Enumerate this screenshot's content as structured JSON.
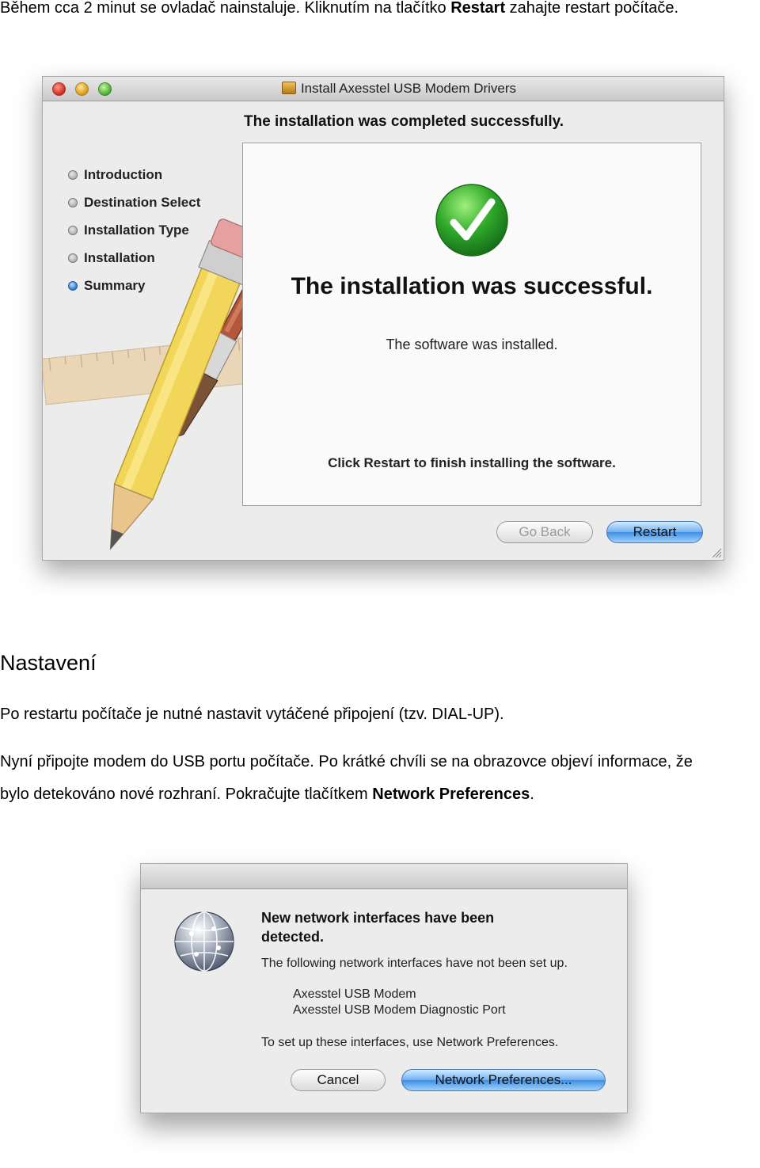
{
  "intro_paragraph": {
    "prefix": "Během cca 2 minut se ovladač nainstaluje. Kliknutím na tlačítko ",
    "bold": "Restart",
    "suffix": " zahajte restart počítače."
  },
  "installer_window": {
    "title": "Install Axesstel USB Modem Drivers",
    "header": "The installation was completed successfully.",
    "steps": [
      {
        "label": "Introduction",
        "active": false
      },
      {
        "label": "Destination Select",
        "active": false
      },
      {
        "label": "Installation Type",
        "active": false
      },
      {
        "label": "Installation",
        "active": false
      },
      {
        "label": "Summary",
        "active": true
      }
    ],
    "success_title": "The installation was successful.",
    "success_sub": "The software was installed.",
    "success_hint": "Click Restart to finish installing the software.",
    "go_back_label": "Go Back",
    "restart_label": "Restart",
    "success_icon": "check-icon",
    "success_color": "#2fa82a"
  },
  "section_heading": "Nastavení",
  "paragraph_2": "Po restartu počítače je nutné nastavit vytáčené připojení (tzv. DIAL-UP).",
  "paragraph_3": {
    "line1": "Nyní připojte modem do USB portu počítače. Po krátké chvíli se na obrazovce objeví informace, že",
    "line2_prefix": "bylo detekováno nové rozhraní. Pokračujte tlačítkem ",
    "line2_bold": "Network Preferences",
    "line2_suffix": "."
  },
  "network_dialog": {
    "heading": "New network interfaces have been detected.",
    "text1": "The following network interfaces have not been set up.",
    "interfaces": [
      "Axesstel USB Modem",
      "Axesstel USB Modem Diagnostic Port"
    ],
    "text2": "To set up these interfaces, use Network Preferences.",
    "cancel_label": "Cancel",
    "network_prefs_label": "Network Preferences...",
    "icon": "network-globe-icon"
  }
}
